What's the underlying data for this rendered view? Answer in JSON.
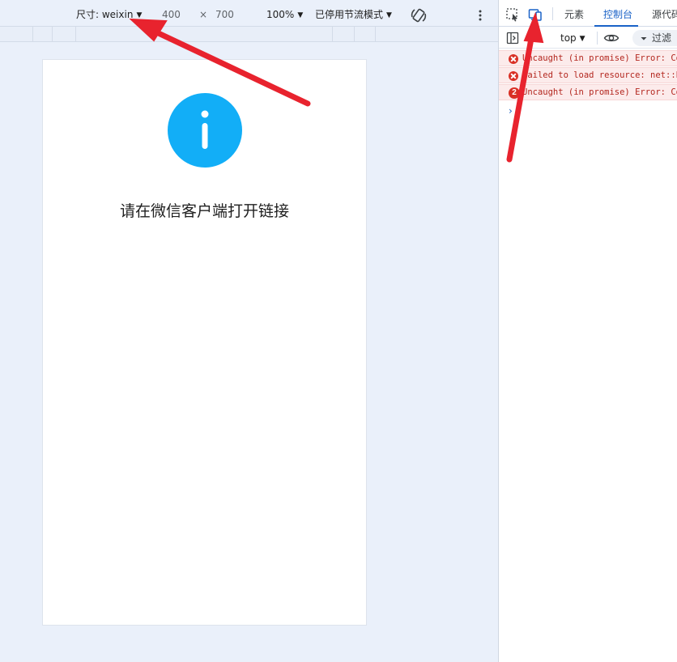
{
  "emulation_toolbar": {
    "device_label": "尺寸: weixin",
    "width": "400",
    "times": "×",
    "height": "700",
    "zoom": "100%",
    "throttle": "已停用节流模式"
  },
  "page": {
    "message": "请在微信客户端打开链接",
    "info_icon_color": "#12aef7"
  },
  "devtools": {
    "tabs": [
      {
        "label": "元素"
      },
      {
        "label": "控制台"
      },
      {
        "label": "源代码"
      }
    ],
    "context": "top",
    "filter_label": "过滤",
    "console": [
      {
        "text": "Uncaught (in promise) Error: Cou",
        "badge": ""
      },
      {
        "text": "Failed to load resource: net::ERR_",
        "badge": ""
      },
      {
        "text": "Uncaught (in promise) Error: Cou",
        "badge": "2"
      }
    ],
    "prompt": "›"
  },
  "colors": {
    "accent_blue": "#1a62c7",
    "error_red": "#d93025",
    "annotation_red": "#e8232e"
  }
}
